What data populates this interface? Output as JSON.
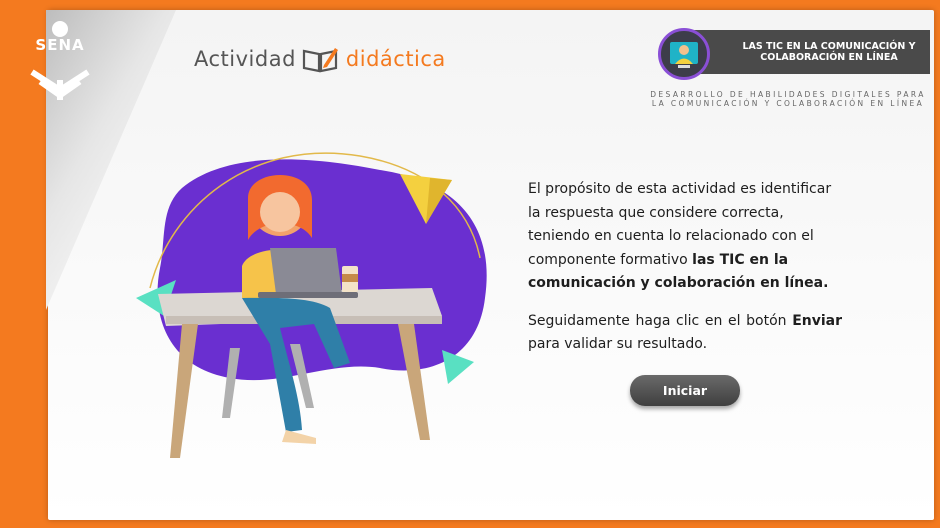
{
  "brand": {
    "logo_text": "SENA"
  },
  "header": {
    "title_part1": "Actividad",
    "title_part2": "didáctica"
  },
  "banner": {
    "title": "LAS TIC EN LA COMUNICACIÓN Y COLABORACIÓN EN LÍNEA",
    "subtitle": "DESARROLLO DE HABILIDADES DIGITALES PARA LA COMUNICACIÓN Y COLABORACIÓN EN LÍNEA"
  },
  "content": {
    "para1_intro": "El propósito de esta actividad es identificar la respuesta que considere correcta, teniendo en cuenta lo relacionado con el componente formativo ",
    "para1_bold": "las TIC en la comunicación y colaboración en línea.",
    "para2_intro": "Seguidamente haga clic en el botón ",
    "para2_bold": "Enviar",
    "para2_end": " para validar su resultado."
  },
  "actions": {
    "start_label": "Iniciar"
  },
  "colors": {
    "brand_orange": "#f47a1f",
    "banner_gray": "#4a4a4a",
    "blob_purple": "#6a2fd0",
    "button_gray": "#555555"
  }
}
